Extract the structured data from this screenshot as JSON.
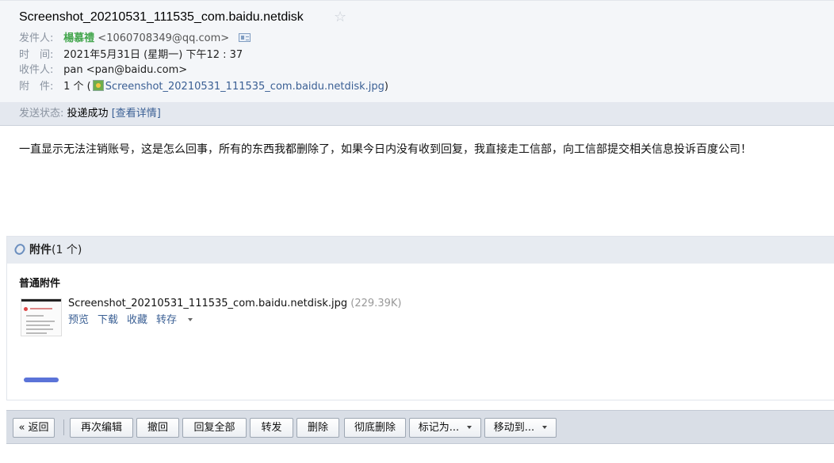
{
  "header": {
    "subject": "Screenshot_20210531_111535_com.baidu.netdisk",
    "from_label": "发件人:",
    "from_name": "楊慕禮",
    "from_addr": "<1060708349@qq.com>",
    "time_label": "时　间:",
    "time_value": "2021年5月31日 (星期一) 下午12 : 37",
    "to_label": "收件人:",
    "to_value": "pan <pan@baidu.com>",
    "att_label": "附　件:",
    "att_count": "1 个 (",
    "att_file": "Screenshot_20210531_111535_com.baidu.netdisk.jpg",
    "att_close": ")",
    "status_label": "发送状态:",
    "status_value": "投递成功",
    "status_link": "[查看详情]"
  },
  "body": {
    "text": "一直显示无法注销账号，这是怎么回事，所有的东西我都删除了，如果今日内没有收到回复，我直接走工信部，向工信部提交相关信息投诉百度公司！"
  },
  "attachments": {
    "title": "附件",
    "count": "(1 个)",
    "section": "普通附件",
    "file_name": "Screenshot_20210531_111535_com.baidu.netdisk.jpg",
    "file_size": "(229.39K)",
    "actions": {
      "preview": "预览",
      "download": "下载",
      "favorite": "收藏",
      "save_to": "转存"
    }
  },
  "toolbar": {
    "back": "« 返回",
    "edit_again": "再次编辑",
    "recall": "撤回",
    "reply_all": "回复全部",
    "forward": "转发",
    "delete": "删除",
    "delete_permanently": "彻底删除",
    "mark_as": "标记为...",
    "move_to": "移动到..."
  },
  "colors": {
    "sender_name": "#43a64d",
    "link": "#3a5f94",
    "header_bg": "#f4f6f9",
    "toolbar_bg": "#d9dee6"
  }
}
